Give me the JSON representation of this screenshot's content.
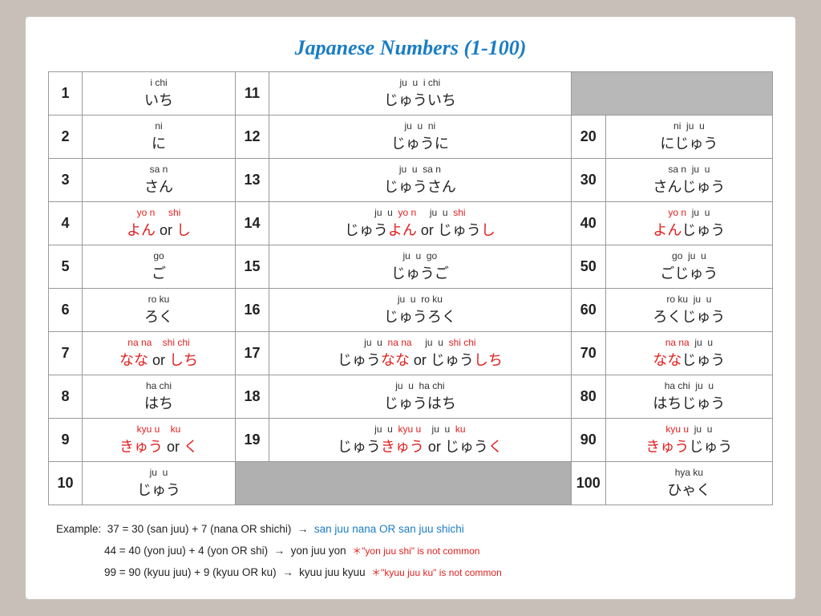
{
  "title": "Japanese Numbers (1-100)",
  "examples": [
    {
      "label": "Example:  37 = 30 (san juu) + 7 (nana OR shichi)  →  ",
      "result": "san juu nana OR san juu shichi",
      "note": null
    },
    {
      "label": "44 = 40 (yon juu) + 4 (yon OR shi)  →  yon juu yon  ",
      "result": null,
      "note": "* \"yon juu shi\" is not common"
    },
    {
      "label": "99 = 90 (kyuu juu) + 9 (kyuu OR ku)  →  kyuu juu kyuu  ",
      "result": null,
      "note": "* \"kyuu juu ku\" is not common"
    }
  ]
}
